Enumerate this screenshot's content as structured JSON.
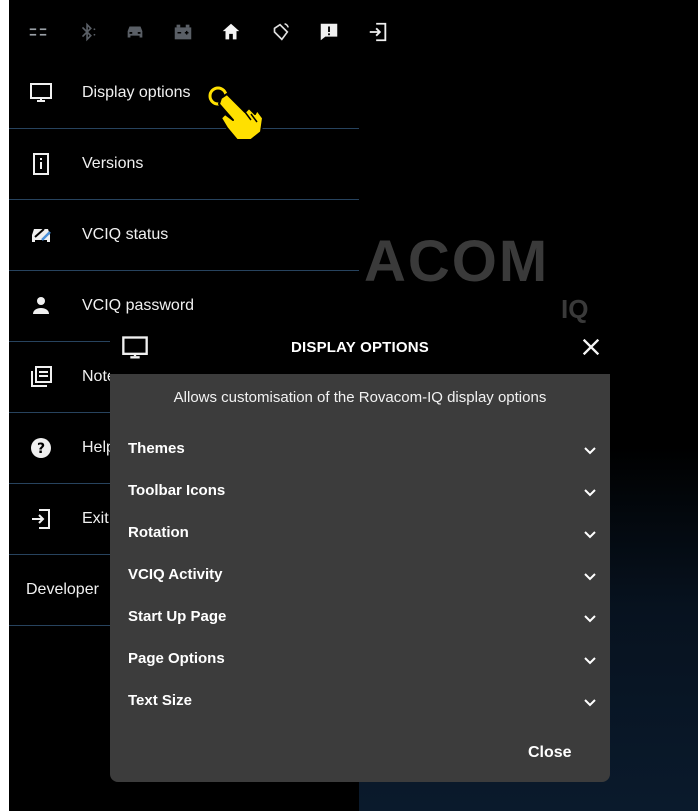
{
  "background": {
    "logo_text": "ACOM",
    "logo_sub": "IQ"
  },
  "toolbar": {
    "icons": [
      "menu-icon",
      "bluetooth-icon",
      "car-icon",
      "battery-icon",
      "home-icon",
      "rotate-icon",
      "alert-icon",
      "exit-icon"
    ]
  },
  "drawer": {
    "items": [
      {
        "label": "Display options",
        "icon": "monitor-icon"
      },
      {
        "label": "Versions",
        "icon": "info-icon"
      },
      {
        "label": "VCIQ status",
        "icon": "car-status-icon"
      },
      {
        "label": "VCIQ password",
        "icon": "person-icon"
      },
      {
        "label": "Notes",
        "icon": "notes-icon"
      },
      {
        "label": "Help",
        "icon": "help-icon"
      },
      {
        "label": "Exit",
        "icon": "exit-icon"
      },
      {
        "label": "Developer"
      }
    ]
  },
  "dialog": {
    "title": "DISPLAY OPTIONS",
    "description": "Allows customisation of the Rovacom-IQ display options",
    "options": [
      "Themes",
      "Toolbar Icons",
      "Rotation",
      "VCIQ Activity",
      "Start Up Page",
      "Page Options",
      "Text Size"
    ],
    "close_label": "Close"
  },
  "colors": {
    "background": "#000000",
    "dialog": "#3c3c3c",
    "divider": "#27435e",
    "pointer": "#ffe000"
  }
}
